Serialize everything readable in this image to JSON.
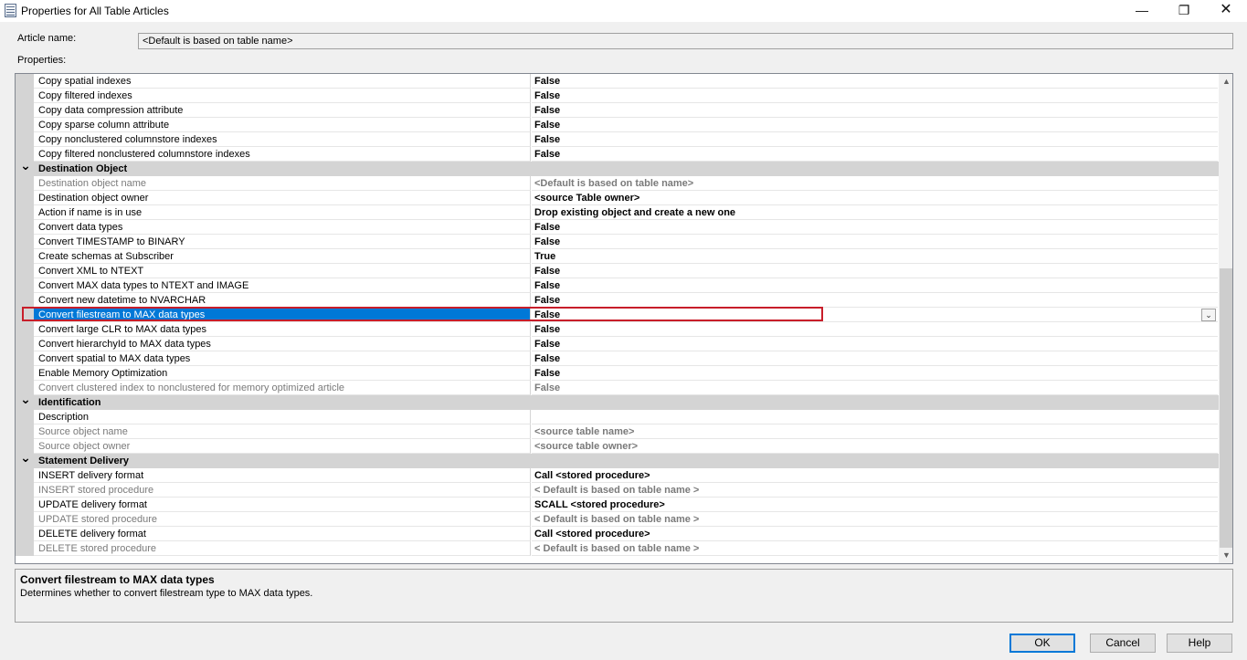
{
  "window": {
    "title": "Properties for All Table Articles",
    "min_glyph": "—",
    "max_glyph": "❐",
    "close_glyph": "✕"
  },
  "article_name": {
    "label": "Article name:",
    "value": "<Default is based on table name>"
  },
  "properties_label": "Properties:",
  "grid": {
    "rows": [
      {
        "kind": "prop",
        "name": "Copy spatial indexes",
        "value": "False"
      },
      {
        "kind": "prop",
        "name": "Copy filtered indexes",
        "value": "False"
      },
      {
        "kind": "prop",
        "name": "Copy data compression attribute",
        "value": "False"
      },
      {
        "kind": "prop",
        "name": "Copy sparse column attribute",
        "value": "False"
      },
      {
        "kind": "prop",
        "name": "Copy nonclustered columnstore indexes",
        "value": "False"
      },
      {
        "kind": "prop",
        "name": "Copy filtered nonclustered columnstore indexes",
        "value": "False"
      },
      {
        "kind": "category",
        "name": "Destination Object",
        "icon": "chevron-down"
      },
      {
        "kind": "prop",
        "name": "Destination object name",
        "value": "<Default is based on table name>",
        "dim": true
      },
      {
        "kind": "prop",
        "name": "Destination object owner",
        "value": "<source Table owner>"
      },
      {
        "kind": "prop",
        "name": "Action if name is in use",
        "value": "Drop existing object and create a new one"
      },
      {
        "kind": "prop",
        "name": "Convert data types",
        "value": "False"
      },
      {
        "kind": "prop",
        "name": "Convert TIMESTAMP to BINARY",
        "value": "False"
      },
      {
        "kind": "prop",
        "name": "Create schemas at Subscriber",
        "value": "True"
      },
      {
        "kind": "prop",
        "name": "Convert XML to NTEXT",
        "value": "False"
      },
      {
        "kind": "prop",
        "name": "Convert MAX data types to NTEXT and IMAGE",
        "value": "False"
      },
      {
        "kind": "prop",
        "name": "Convert new datetime to NVARCHAR",
        "value": "False"
      },
      {
        "kind": "prop",
        "name": "Convert filestream to MAX data types",
        "value": "False",
        "selected": true
      },
      {
        "kind": "prop",
        "name": "Convert large CLR to MAX data types",
        "value": "False"
      },
      {
        "kind": "prop",
        "name": "Convert hierarchyId to MAX data types",
        "value": "False"
      },
      {
        "kind": "prop",
        "name": "Convert spatial to MAX data types",
        "value": "False"
      },
      {
        "kind": "prop",
        "name": "Enable Memory Optimization",
        "value": "False"
      },
      {
        "kind": "prop",
        "name": "Convert clustered index to nonclustered for memory optimized article",
        "value": "False",
        "dim": true
      },
      {
        "kind": "category",
        "name": "Identification",
        "icon": "chevron-down"
      },
      {
        "kind": "prop",
        "name": "Description",
        "value": ""
      },
      {
        "kind": "prop",
        "name": "Source object name",
        "value": "<source table name>",
        "dim": true
      },
      {
        "kind": "prop",
        "name": "Source object owner",
        "value": "<source table owner>",
        "dim": true
      },
      {
        "kind": "category",
        "name": "Statement Delivery",
        "icon": "chevron-down"
      },
      {
        "kind": "prop",
        "name": "INSERT delivery format",
        "value": "Call <stored procedure>"
      },
      {
        "kind": "prop",
        "name": "INSERT stored procedure",
        "value": "< Default is based on table name >",
        "dim": true
      },
      {
        "kind": "prop",
        "name": "UPDATE delivery format",
        "value": "SCALL <stored procedure>"
      },
      {
        "kind": "prop",
        "name": "UPDATE stored procedure",
        "value": "< Default is based on table name >",
        "dim": true
      },
      {
        "kind": "prop",
        "name": "DELETE delivery format",
        "value": "Call <stored procedure>"
      },
      {
        "kind": "prop",
        "name": "DELETE stored procedure",
        "value": "< Default is based on table name >",
        "dim": true
      }
    ]
  },
  "description": {
    "title": "Convert filestream to MAX data types",
    "text": "Determines whether to convert filestream type to MAX data types."
  },
  "buttons": {
    "ok": "OK",
    "cancel": "Cancel",
    "help": "Help"
  },
  "colors": {
    "selection": "#0078d7",
    "highlight_border": "#c81e2a",
    "category_bg": "#d4d4d4"
  }
}
